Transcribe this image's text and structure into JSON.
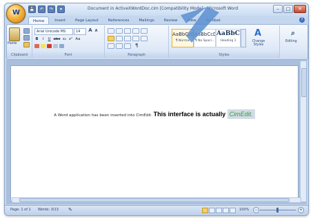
{
  "window": {
    "title": "Document in ActiveXWordDoc.cim [Compatibility Mode] - Microsoft Word",
    "minimize": "–",
    "maximize": "□",
    "close": "✕"
  },
  "office_button": {
    "glyph": "W"
  },
  "quick_access": [
    "💾",
    "↶",
    "↷",
    "▾"
  ],
  "tabs": [
    "Home",
    "Insert",
    "Page Layout",
    "References",
    "Mailings",
    "Review",
    "View",
    "Acrobat"
  ],
  "active_tab": "Home",
  "help_icon": "?",
  "ribbon": {
    "clipboard": {
      "paste": "Paste",
      "label": "Clipboard"
    },
    "font": {
      "name": "Arial Unicode MS",
      "size": "14",
      "bold": "B",
      "italic": "I",
      "underline": "U",
      "strike": "abc",
      "sub": "x₂",
      "sup": "x²",
      "aa": "Aa",
      "grow": "A",
      "shrink": "A",
      "label": "Font"
    },
    "paragraph": {
      "label": "Paragraph",
      "pilcrow": "¶"
    },
    "styles": {
      "items": [
        {
          "sample": "AaBbCcDc",
          "name": "¶ Normal"
        },
        {
          "sample": "AaBbCcDc",
          "name": "¶ No Spaci..."
        },
        {
          "sample": "AaBbC",
          "name": "Heading 1"
        }
      ],
      "change_styles": "Change Styles",
      "label": "Styles"
    },
    "editing": {
      "label": "Editing"
    }
  },
  "document": {
    "text_small": "A Word application has been inserted into CimEdit. ",
    "text_bold": "This interface is actually ",
    "text_highlight": "CimEdit."
  },
  "status_bar": {
    "page": "Page: 1 of 1",
    "words": "Words: 3/13",
    "zoom": "100%",
    "zoom_minus": "−",
    "zoom_plus": "+"
  },
  "colors": {
    "highlight_text": "#2f9d3c",
    "highlight_bg": "#d3dbe5",
    "cursor_arrow": "#5b8fd0"
  }
}
